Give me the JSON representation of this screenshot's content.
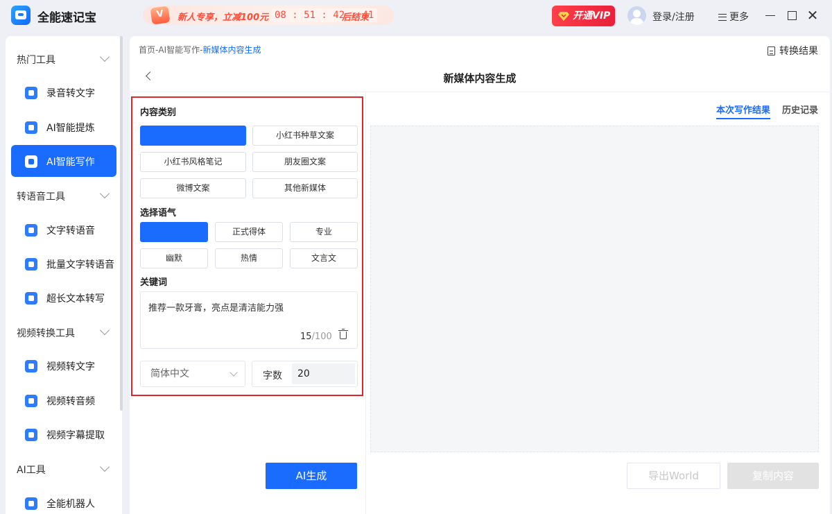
{
  "app": {
    "title": "全能速记宝"
  },
  "promo": {
    "badge": "V",
    "text": "新人专享，立减100元",
    "countdown": "08 : 51 : 42 : 41",
    "suffix": "后结束"
  },
  "header": {
    "vip_label": "开通VIP",
    "login_label": "登录/注册",
    "more_label": "更多"
  },
  "sidebar": {
    "groups": [
      {
        "label": "热门工具",
        "items": [
          {
            "label": "录音转文字"
          },
          {
            "label": "AI智能提炼"
          },
          {
            "label": "AI智能写作",
            "active": true
          }
        ]
      },
      {
        "label": "转语音工具",
        "items": [
          {
            "label": "文字转语音"
          },
          {
            "label": "批量文字转语音"
          },
          {
            "label": "超长文本转写"
          }
        ]
      },
      {
        "label": "视频转换工具",
        "items": [
          {
            "label": "视频转文字"
          },
          {
            "label": "视频转音频"
          },
          {
            "label": "视频字幕提取"
          }
        ]
      },
      {
        "label": "AI工具",
        "items": [
          {
            "label": "全能机器人"
          }
        ]
      }
    ]
  },
  "main": {
    "breadcrumb": {
      "home": "首页",
      "sep": "-",
      "parent": "AI智能写作",
      "current": "新媒体内容生成"
    },
    "convert_result_label": "转换结果",
    "page_title": "新媒体内容生成",
    "form": {
      "content_type_title": "内容类别",
      "content_types": [
        "",
        "小红书种草文案",
        "小红书风格笔记",
        "朋友圈文案",
        "微博文案",
        "其他新媒体"
      ],
      "tone_title": "选择语气",
      "tones": [
        "",
        "正式得体",
        "专业",
        "幽默",
        "热情",
        "文言文"
      ],
      "keyword_title": "关键词",
      "keyword_value": "推荐一款牙膏，亮点是清洁能力强",
      "keyword_count": "15",
      "keyword_max": "/100",
      "language_value": "简体中文",
      "word_count_label": "字数",
      "word_count_value": "20"
    },
    "generate_label": "AI生成",
    "tabs": {
      "current": "本次写作结果",
      "history": "历史记录"
    },
    "export_label": "导出World",
    "copy_label": "复制内容"
  }
}
